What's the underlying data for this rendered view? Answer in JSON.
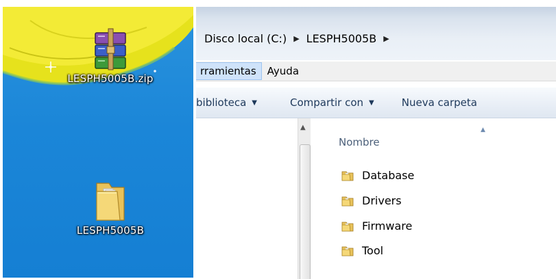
{
  "desktop": {
    "icons": [
      {
        "label": "LESPH5005B.zip",
        "icon": "winrar-archive-icon"
      },
      {
        "label": "LESPH5005B",
        "icon": "folder-icon"
      }
    ]
  },
  "explorer": {
    "breadcrumb": [
      {
        "label": "Disco local (C:)"
      },
      {
        "label": "LESPH5005B"
      }
    ],
    "menubar": [
      {
        "label": "rramientas"
      },
      {
        "label": "Ayuda"
      }
    ],
    "toolbar": [
      {
        "label": "biblioteca"
      },
      {
        "label": "Compartir con"
      },
      {
        "label": "Nueva carpeta"
      }
    ],
    "column_header": "Nombre",
    "files": [
      {
        "name": "Database",
        "icon": "folder-icon"
      },
      {
        "name": "Drivers",
        "icon": "folder-icon"
      },
      {
        "name": "Firmware",
        "icon": "folder-icon"
      },
      {
        "name": "Tool",
        "icon": "folder-icon"
      }
    ]
  },
  "colors": {
    "desktop_bg": "#1b86d8",
    "highlight": "#cfe3fa",
    "toolbar_text": "#1e395b"
  }
}
